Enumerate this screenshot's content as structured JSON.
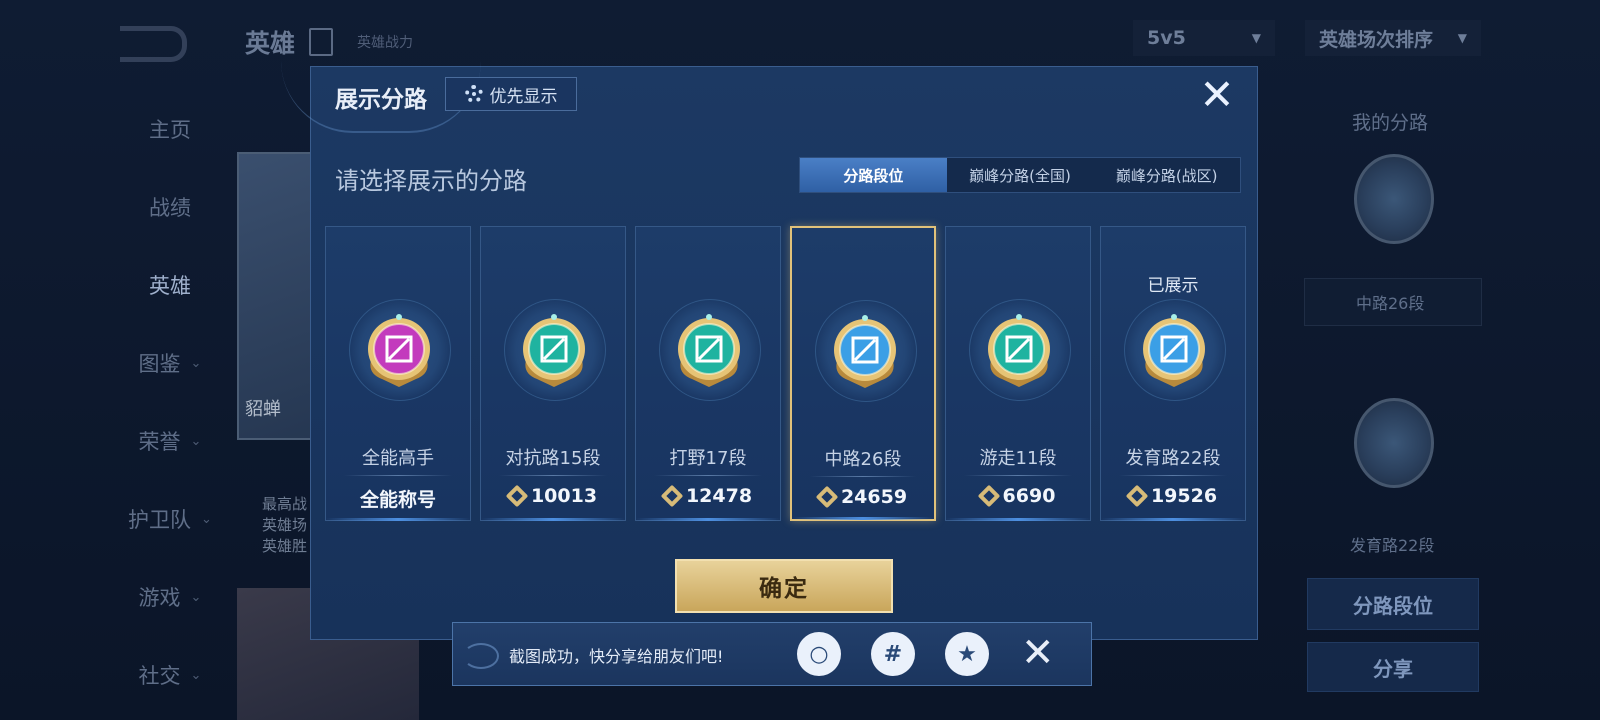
{
  "background": {
    "nav_items": [
      {
        "label": "主页",
        "has_arrow": false
      },
      {
        "label": "战绩",
        "has_arrow": false
      },
      {
        "label": "英雄",
        "has_arrow": false,
        "active": true
      },
      {
        "label": "图鉴",
        "has_arrow": true
      },
      {
        "label": "荣誉",
        "has_arrow": true
      },
      {
        "label": "护卫队",
        "has_arrow": true
      },
      {
        "label": "游戏",
        "has_arrow": true
      },
      {
        "label": "社交",
        "has_arrow": true
      }
    ],
    "header_title": "英雄",
    "header_sub": "英雄战力",
    "mode_select": "5v5",
    "sort_select": "英雄场次排序",
    "hero_card_name": "貂蝉",
    "hero_card_text": "最高战\n英雄场\n英雄胜",
    "my_lane_label": "我的分路",
    "my_lane_rank_1": "中路26段",
    "my_lane_rank_2": "发育路22段",
    "lane_rank_button": "分路段位",
    "share_button": "分享"
  },
  "modal": {
    "title": "展示分路",
    "priority_button": "优先显示",
    "close_icon": "close-icon",
    "subtitle": "请选择展示的分路",
    "tabs": [
      {
        "label": "分路段位",
        "active": true
      },
      {
        "label": "巅峰分路(全国)",
        "active": false
      },
      {
        "label": "巅峰分路(战区)",
        "active": false
      }
    ],
    "lanes": [
      {
        "name": "全能高手",
        "value": "全能称号",
        "icon": "all-round-emblem-icon",
        "color": "#c33bbd",
        "show_rank_icon": false,
        "selected": false,
        "shown_label": ""
      },
      {
        "name": "对抗路15段",
        "value": "10013",
        "icon": "clash-lane-emblem-icon",
        "color": "#1fb3a0",
        "show_rank_icon": true,
        "selected": false,
        "shown_label": ""
      },
      {
        "name": "打野17段",
        "value": "12478",
        "icon": "jungle-emblem-icon",
        "color": "#1fb3a0",
        "show_rank_icon": true,
        "selected": false,
        "shown_label": ""
      },
      {
        "name": "中路26段",
        "value": "24659",
        "icon": "mid-lane-emblem-icon",
        "color": "#3b9fe6",
        "show_rank_icon": true,
        "selected": true,
        "shown_label": ""
      },
      {
        "name": "游走11段",
        "value": "6690",
        "icon": "roam-emblem-icon",
        "color": "#1fb3a0",
        "show_rank_icon": true,
        "selected": false,
        "shown_label": ""
      },
      {
        "name": "发育路22段",
        "value": "19526",
        "icon": "farm-lane-emblem-icon",
        "color": "#3b9fe6",
        "show_rank_icon": true,
        "selected": false,
        "shown_label": "已展示"
      }
    ],
    "confirm_button": "确定"
  },
  "toast": {
    "message": "截图成功，快分享给朋友们吧!",
    "share_targets": [
      {
        "icon": "qq-icon"
      },
      {
        "icon": "moments-icon"
      },
      {
        "icon": "qzone-icon"
      }
    ]
  },
  "colors": {
    "accent_gold": "#e1c27a",
    "active_tab": "#3b6fb8"
  }
}
